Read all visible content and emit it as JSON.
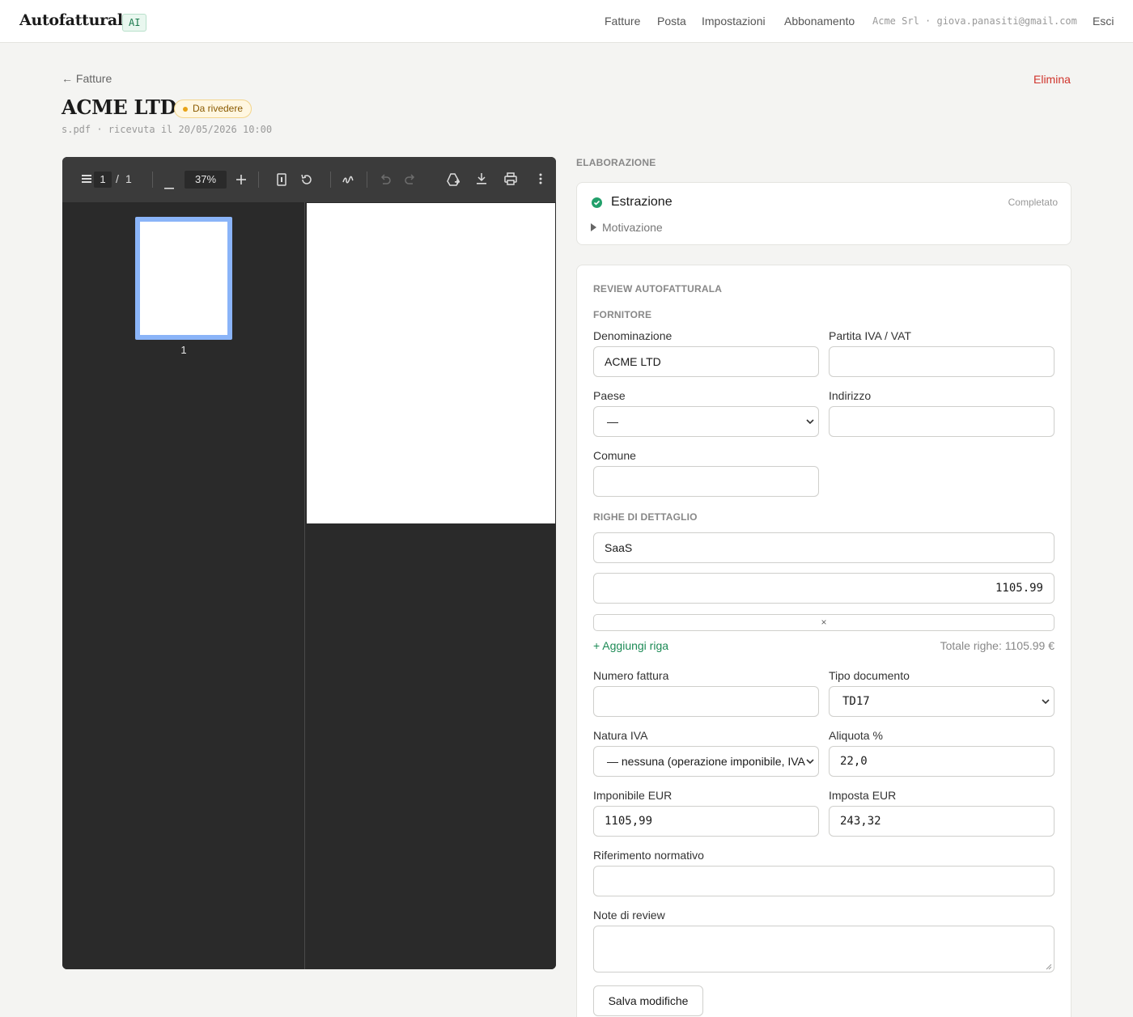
{
  "app": {
    "brand": "Autofatturala",
    "ai_badge": "AI"
  },
  "nav": {
    "items": [
      "Fatture",
      "Posta",
      "Impostazioni",
      "Abbonamento"
    ],
    "account": "Acme Srl · giova.panasiti@gmail.com",
    "logout": "Esci"
  },
  "header": {
    "back_label": "← Fatture",
    "delete_label": "Elimina",
    "title": "ACME LTD",
    "status": "Da rivedere",
    "subtitle": "s.pdf · ricevuta il 20/05/2026 10:00"
  },
  "viewer": {
    "page_current": "1",
    "page_sep": "/",
    "page_total": "1",
    "zoom": "37%",
    "thumb_label": "1",
    "icons": [
      "menu-icon",
      "zoom-out-icon",
      "zoom-in-icon",
      "fit-page-icon",
      "rotate-icon",
      "draw-icon",
      "undo-icon",
      "redo-icon",
      "add-to-drive-icon",
      "download-icon",
      "print-icon",
      "more-icon"
    ]
  },
  "processing": {
    "section_label": "ELABORAZIONE",
    "step_title": "Estrazione",
    "step_status": "Completato",
    "disclosure": "Motivazione"
  },
  "review": {
    "section_label": "REVIEW AUTOFATTURALA",
    "supplier_label": "FORNITORE",
    "denominazione": {
      "label": "Denominazione",
      "value": "ACME LTD"
    },
    "partita_iva": {
      "label": "Partita IVA / VAT",
      "value": ""
    },
    "paese": {
      "label": "Paese",
      "value": "—"
    },
    "indirizzo": {
      "label": "Indirizzo",
      "value": ""
    },
    "comune": {
      "label": "Comune",
      "value": ""
    },
    "lines_label": "RIGHE DI DETTAGLIO",
    "lines": [
      {
        "description": "SaaS",
        "amount": "1105.99",
        "remove": "×"
      }
    ],
    "add_line": "+ Aggiungi riga",
    "total_lines": "Totale righe: 1105.99 €",
    "numero_fattura": {
      "label": "Numero fattura",
      "value": ""
    },
    "tipo_documento": {
      "label": "Tipo documento",
      "value": "TD17"
    },
    "natura_iva": {
      "label": "Natura IVA",
      "value": "— nessuna (operazione imponibile, IVA"
    },
    "aliquota": {
      "label": "Aliquota %",
      "value": "22,0"
    },
    "imponibile": {
      "label": "Imponibile EUR",
      "value": "1105,99"
    },
    "imposta": {
      "label": "Imposta EUR",
      "value": "243,32"
    },
    "riferimento": {
      "label": "Riferimento normativo",
      "value": ""
    },
    "note": {
      "label": "Note di review",
      "value": ""
    },
    "save_label": "Salva modifiche"
  },
  "colors": {
    "accent_green": "#1c8a55",
    "danger": "#d0342c",
    "warning": "#e8a317",
    "viewer_bg": "#2a2a2a",
    "thumb_border": "#8ab4f8"
  }
}
